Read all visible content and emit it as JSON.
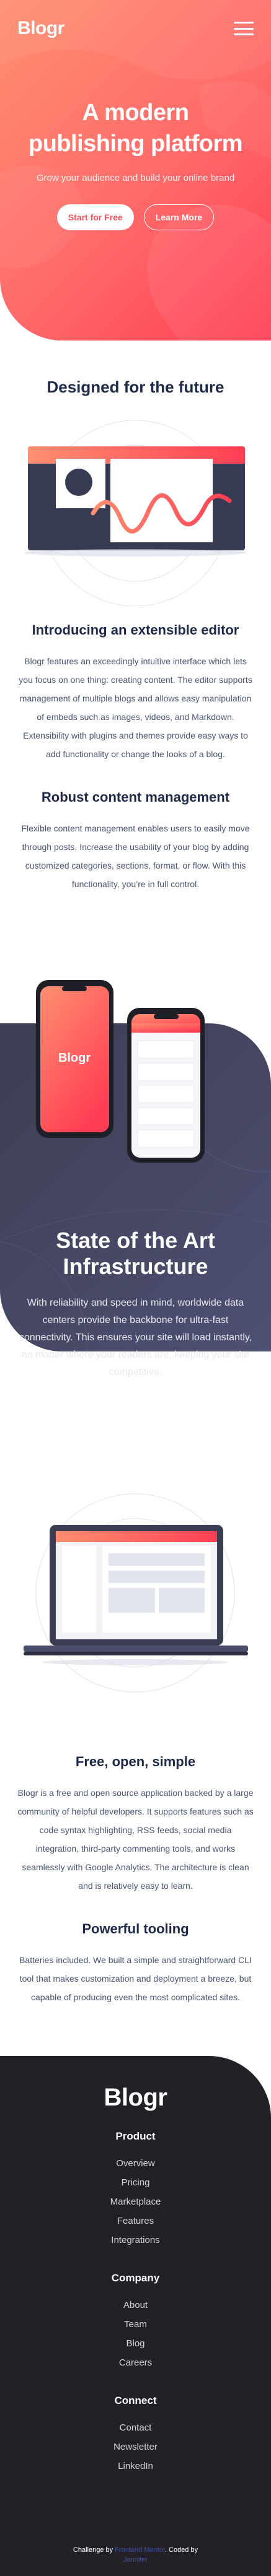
{
  "header": {
    "logo": "Blogr",
    "title": "A modern publishing platform",
    "title_line1": "A modern",
    "title_line2": "publishing platform",
    "subtitle": "Grow your audience and build your online brand",
    "start_button": "Start for Free",
    "learn_button": "Learn More"
  },
  "future": {
    "heading": "Designed for the future",
    "editor_heading": "Introducing an extensible editor",
    "editor_text": "Blogr features an exceedingly intuitive interface which lets you focus on one thing: creating content. The editor supports management of multiple blogs and allows easy manipulation of embeds such as images, videos, and Markdown. Extensibility with plugins and themes provide easy ways to add functionality or change the looks of a blog.",
    "content_heading": "Robust content management",
    "content_text": "Flexible content management enables users to easily move through posts. Increase the usability of your blog by adding customized categories, sections, format, or flow. With this functionality, you’re in full control."
  },
  "state": {
    "phone_logo": "Blogr",
    "heading_line1": "State of the Art",
    "heading_line2": "Infrastructure",
    "text": "With reliability and speed in mind, worldwide data centers provide the backbone for ultra-fast connectivity. This ensures your site will load instantly, no matter where your readers are, keeping your site competitive."
  },
  "features": {
    "free_heading": "Free, open, simple",
    "free_text": "Blogr is a free and open source application backed by a large community of helpful developers. It supports features such as code syntax highlighting, RSS feeds, social media integration, third-party commenting tools, and works seamlessly with Google Analytics. The architecture is clean and is relatively easy to learn.",
    "tooling_heading": "Powerful tooling",
    "tooling_text": "Batteries included. We built a simple and straightforward CLI tool that makes customization and deployment a breeze, but capable of producing even the most complicated sites."
  },
  "footer": {
    "logo": "Blogr",
    "columns": [
      {
        "title": "Product",
        "links": [
          "Overview",
          "Pricing",
          "Marketplace",
          "Features",
          "Integrations"
        ]
      },
      {
        "title": "Company",
        "links": [
          "About",
          "Team",
          "Blog",
          "Careers"
        ]
      },
      {
        "title": "Connect",
        "links": [
          "Contact",
          "Newsletter",
          "LinkedIn"
        ]
      }
    ],
    "attribution_prefix": "Challenge by",
    "attribution_challenge": "Frontend Mentor",
    "attribution_middle": ". Coded by",
    "attribution_author": "Jennifer"
  },
  "colors": {
    "hero_start": "#ff8f70",
    "hero_end": "#ff3e54",
    "navy": "#1f2a4b",
    "dark_section": "#3d3e54",
    "footer_bg": "#232127"
  },
  "icons": {
    "menu": "hamburger-menu-icon"
  }
}
